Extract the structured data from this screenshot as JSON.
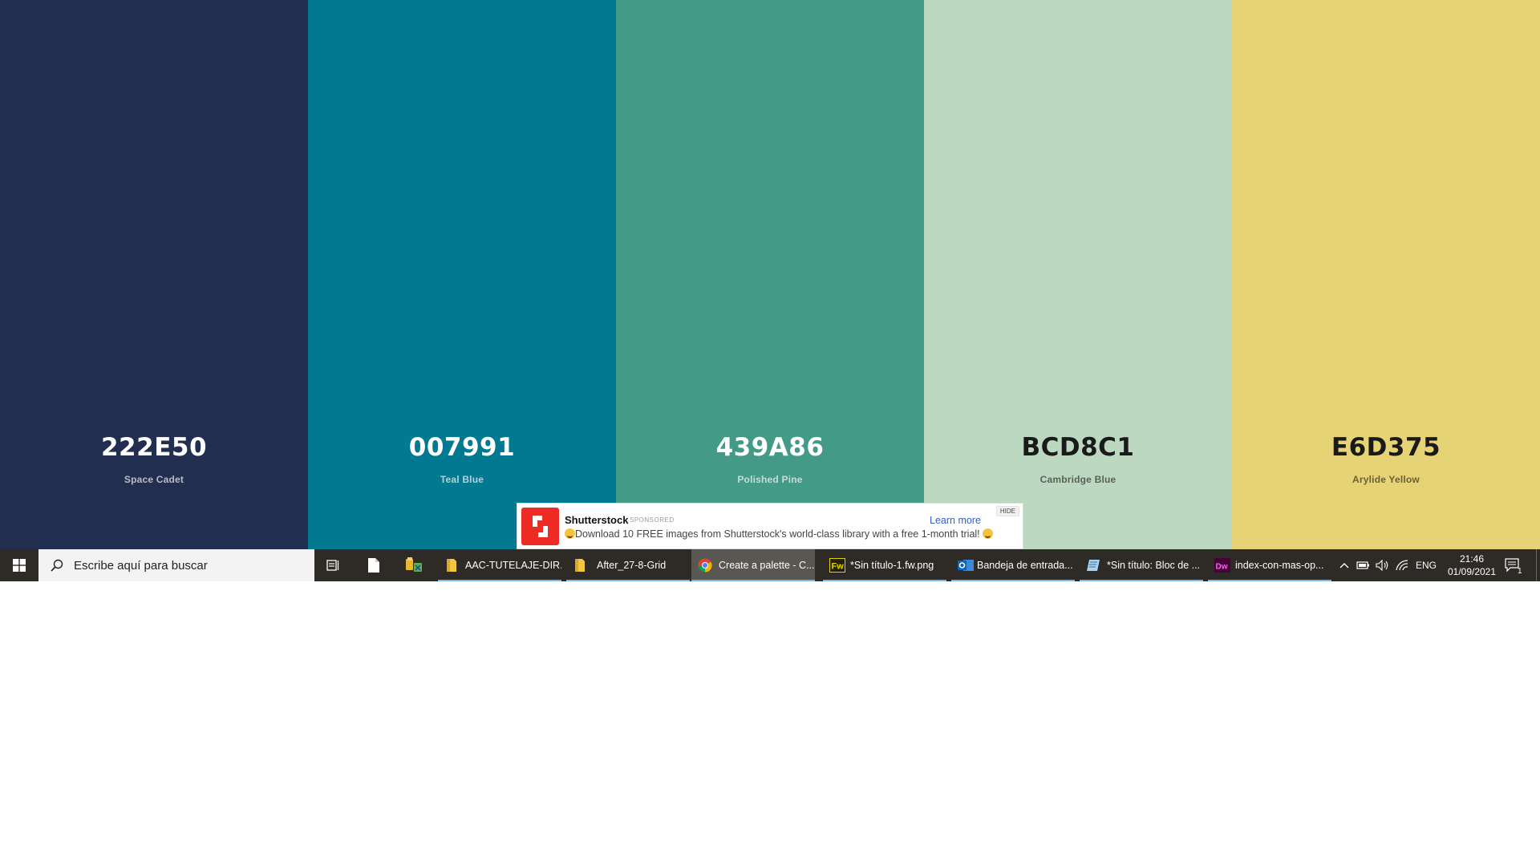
{
  "palette": {
    "swatches": [
      {
        "hex": "222E50",
        "name": "Space Cadet",
        "color": "#222E50",
        "tone": "dark"
      },
      {
        "hex": "007991",
        "name": "Teal Blue",
        "color": "#007991",
        "tone": "dark"
      },
      {
        "hex": "439A86",
        "name": "Polished Pine",
        "color": "#439A86",
        "tone": "dark"
      },
      {
        "hex": "BCD8C1",
        "name": "Cambridge Blue",
        "color": "#BCD8C1",
        "tone": "light"
      },
      {
        "hex": "E6D375",
        "name": "Arylide Yellow",
        "color": "#E6D375",
        "tone": "light"
      }
    ]
  },
  "ad": {
    "title": "Shutterstock",
    "sponsored": "SPONSORED",
    "text": "Download 10 FREE images from Shutterstock's world-class library with a free 1-month trial!",
    "learn_more": "Learn more",
    "hide": "HIDE",
    "brand_color": "#EE2B24"
  },
  "taskbar": {
    "search_placeholder": "Escribe aquí para buscar",
    "apps": [
      {
        "label": "AAC-TUTELAJE-DIR...",
        "icon": "folder-icon",
        "active": false
      },
      {
        "label": "After_27-8-Grid",
        "icon": "folder-icon",
        "active": false
      },
      {
        "label": "Create a palette - C...",
        "icon": "chrome-icon",
        "active": true
      },
      {
        "label": "*Sin título-1.fw.png",
        "icon": "fireworks-icon",
        "active": false
      },
      {
        "label": "Bandeja de entrada...",
        "icon": "outlook-icon",
        "active": false
      },
      {
        "label": "*Sin título: Bloc de ...",
        "icon": "notepad-icon",
        "active": false
      },
      {
        "label": "index-con-mas-op...",
        "icon": "dreamweaver-icon",
        "active": false
      }
    ],
    "language": "ENG",
    "time": "21:46",
    "date": "01/09/2021",
    "notification_count": "1",
    "background": "#2E2A26",
    "accent": "#76B9ED"
  }
}
